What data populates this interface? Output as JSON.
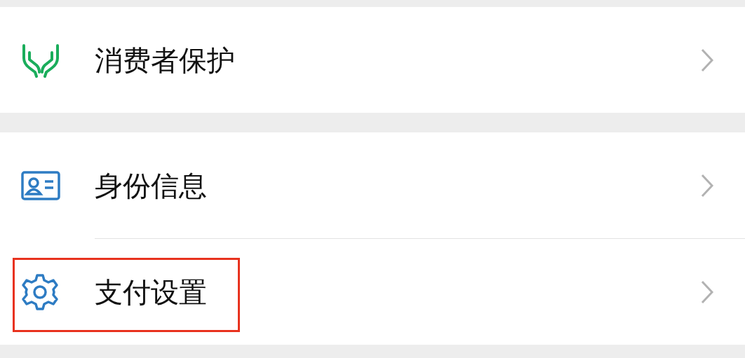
{
  "groups": [
    {
      "items": [
        {
          "kind": "protection",
          "label": "消费者保护",
          "highlighted": false
        }
      ]
    },
    {
      "items": [
        {
          "kind": "identity",
          "label": "身份信息",
          "highlighted": false
        },
        {
          "kind": "settings",
          "label": "支付设置",
          "highlighted": true
        }
      ]
    }
  ]
}
